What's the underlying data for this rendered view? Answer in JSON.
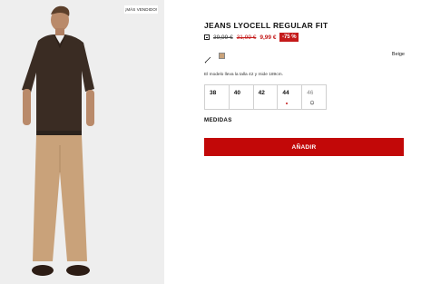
{
  "image": {
    "badge": "¡MÁS VENDIDO!",
    "alt_icon": "model-photo"
  },
  "product": {
    "title": "JEANS LYOCELL REGULAR FIT",
    "price_old": "39,99 €",
    "price_old_2": "31,99 €",
    "price_new": "9,99 €",
    "discount": "-75 %",
    "color_name": "Beige",
    "model_note": "El modelo lleva la talla 42 y mide 189cm."
  },
  "sizes": [
    {
      "label": "38",
      "state": "available"
    },
    {
      "label": "40",
      "state": "available"
    },
    {
      "label": "42",
      "state": "available"
    },
    {
      "label": "44",
      "state": "few-left"
    },
    {
      "label": "46",
      "state": "notify"
    }
  ],
  "medidas_label": "MEDIDAS",
  "add_button_label": "AÑADIR",
  "colors": {
    "accent_red": "#c20808",
    "swatch": "#c9a27a",
    "photo_bg": "#eeeeee"
  },
  "icons": {
    "info": "info-icon",
    "pencil": "pencil-icon",
    "bell": "bell-icon"
  }
}
